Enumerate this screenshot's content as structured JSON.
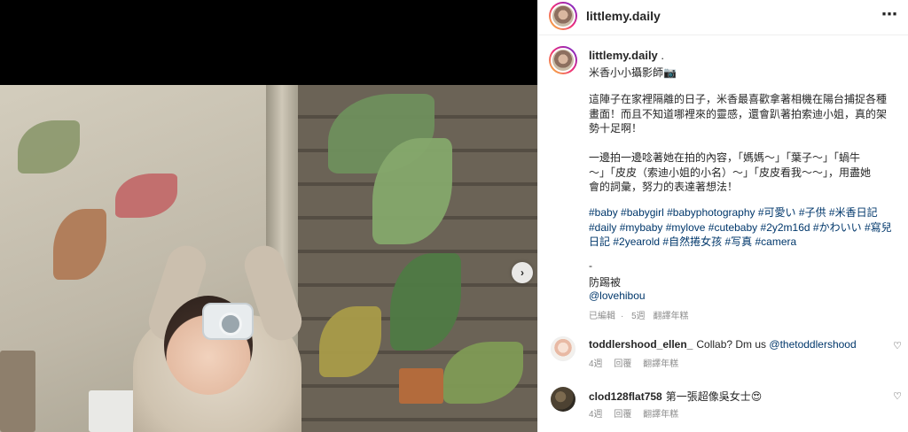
{
  "header": {
    "username": "littlemy.daily"
  },
  "post": {
    "username": "littlemy.daily",
    "username_suffix": ".",
    "subtitle": "米香小小攝影師📷",
    "caption": "這陣子在家裡隔離的日子，米香最喜歡拿著相機在陽台捕捉各種\n畫面！而且不知道哪裡來的靈感，還會趴著拍索迪小姐，真的架\n勢十足啊！\n\n一邊拍一邊唸著她在拍的內容，「媽媽～」「葉子～」「蝸牛\n～」「皮皮（索迪小姐的小名）～」「皮皮看我～～」，用盡她\n會的詞彙，努力的表達著想法！",
    "hashtags": [
      "#baby",
      "#babygirl",
      "#babyphotography",
      "#可愛い",
      "#子供",
      "#米香日記",
      "#daily",
      "#mybaby",
      "#mylove",
      "#cutebaby",
      "#2y2m16d",
      "#かわいい",
      "#寫兒日記",
      "#2yearold",
      "#自然捲女孩",
      "#写真",
      "#camera"
    ],
    "dash": "-",
    "credit_label": "防踢被",
    "credit_link": "@lovehibou",
    "meta": {
      "edited": "已編輯",
      "age": "5週",
      "translate": "翻譯年糕"
    }
  },
  "comments": [
    {
      "username": "toddlershood_ellen_",
      "text": "Collab? Dm us ",
      "mention": "@thetoddlershood",
      "age": "4週",
      "reply": "回覆",
      "translate": "翻譯年糕"
    },
    {
      "username": "clod128flat758",
      "text": "第一張超像吳女士😍",
      "mention": "",
      "age": "4週",
      "reply": "回覆",
      "translate": "翻譯年糕"
    }
  ],
  "icons": {
    "more": "⋯",
    "next": "›",
    "heart": "♡"
  },
  "colors": {
    "link": "#00376b",
    "muted": "#8e8e8e",
    "text": "#262626"
  }
}
